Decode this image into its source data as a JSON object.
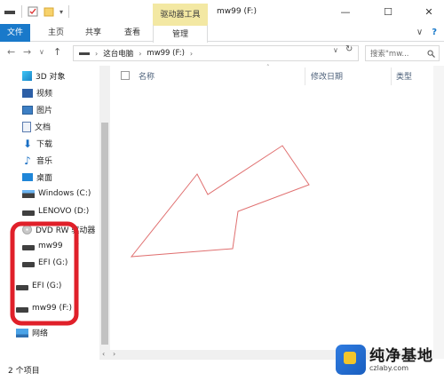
{
  "window": {
    "title": "mw99 (F:)",
    "context_tab_group": "驱动器工具",
    "minimize_glyph": "—",
    "maximize_glyph": "☐",
    "close_glyph": "✕"
  },
  "ribbon": {
    "tabs": [
      "文件",
      "主页",
      "共享",
      "查看",
      "管理"
    ],
    "collapse_glyph": "∨",
    "help_glyph": "?"
  },
  "address": {
    "back_glyph": "←",
    "forward_glyph": "→",
    "recent_glyph": "∨",
    "up_glyph": "↑",
    "crumbs": [
      "这台电脑",
      "mw99 (F:)"
    ],
    "search_placeholder": "搜索\"mw...",
    "refresh_glyph": "↻"
  },
  "nav": {
    "items": [
      {
        "label": "3D 对象",
        "icon": "3d-objects-icon"
      },
      {
        "label": "视频",
        "icon": "video-folder-icon"
      },
      {
        "label": "图片",
        "icon": "pictures-folder-icon"
      },
      {
        "label": "文档",
        "icon": "documents-folder-icon"
      },
      {
        "label": "下载",
        "icon": "downloads-folder-icon"
      },
      {
        "label": "音乐",
        "icon": "music-folder-icon"
      },
      {
        "label": "桌面",
        "icon": "desktop-folder-icon"
      },
      {
        "label": "Windows (C:)",
        "icon": "windows-drive-icon"
      },
      {
        "label": "LENOVO (D:)",
        "icon": "drive-icon"
      },
      {
        "label": "DVD RW 驱动器",
        "icon": "dvd-drive-icon"
      },
      {
        "label": "mw99",
        "icon": "drive-icon"
      },
      {
        "label": "EFI (G:)",
        "icon": "drive-icon"
      },
      {
        "label": "EFI (G:)",
        "icon": "drive-icon"
      },
      {
        "label": "mw99 (F:)",
        "icon": "drive-icon"
      },
      {
        "label": "网络",
        "icon": "network-icon"
      }
    ]
  },
  "content": {
    "columns": [
      "名称",
      "修改日期",
      "类型"
    ]
  },
  "status": {
    "item_count": "2 个项目"
  },
  "colors": {
    "accent": "#1979ca",
    "context_tab": "#f3e8a3",
    "annotation_red": "#e0202a",
    "annotation_arrow": "#e07070"
  },
  "watermark": {
    "brand": "纯净基地",
    "site": "czlaby.com"
  }
}
